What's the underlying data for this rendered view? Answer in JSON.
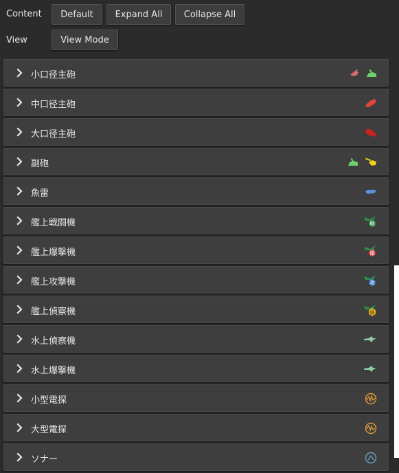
{
  "toolbar": {
    "content_label": "Content",
    "default_button": "Default",
    "expand_all_button": "Expand All",
    "collapse_all_button": "Collapse All",
    "view_label": "View",
    "view_mode_button": "View Mode"
  },
  "categories": [
    {
      "label": "小口径主砲",
      "icons": [
        "small-main-gun-red-icon",
        "small-main-gun-green-icon"
      ]
    },
    {
      "label": "中口径主砲",
      "icons": [
        "medium-main-gun-icon"
      ]
    },
    {
      "label": "大口径主砲",
      "icons": [
        "large-main-gun-icon"
      ]
    },
    {
      "label": "副砲",
      "icons": [
        "secondary-gun-green-icon",
        "secondary-gun-yellow-icon"
      ]
    },
    {
      "label": "魚雷",
      "icons": [
        "torpedo-icon"
      ]
    },
    {
      "label": "艦上戦闘機",
      "icons": [
        "carrier-fighter-icon"
      ]
    },
    {
      "label": "艦上爆撃機",
      "icons": [
        "carrier-dive-bomber-icon"
      ]
    },
    {
      "label": "艦上攻撃機",
      "icons": [
        "carrier-torpedo-bomber-icon"
      ]
    },
    {
      "label": "艦上偵察機",
      "icons": [
        "carrier-recon-icon"
      ]
    },
    {
      "label": "水上偵察機",
      "icons": [
        "seaplane-recon-icon"
      ]
    },
    {
      "label": "水上爆撃機",
      "icons": [
        "seaplane-bomber-icon"
      ]
    },
    {
      "label": "小型電探",
      "icons": [
        "small-radar-icon"
      ]
    },
    {
      "label": "大型電探",
      "icons": [
        "large-radar-icon"
      ]
    },
    {
      "label": "ソナー",
      "icons": [
        "sonar-icon"
      ]
    }
  ],
  "colors": {
    "background": "#2b2b2b",
    "row": "#3e3e3e",
    "button": "#3d3d3d",
    "text": "#e6e6e6",
    "gun_red_light": "#d86a6a",
    "gun_red": "#e0433e",
    "gun_red_dark": "#c8231f",
    "gun_green": "#6fcf6f",
    "gun_yellow": "#f2d21a",
    "torpedo_blue": "#5b8fd6",
    "aircraft_green": "#2f8f4a",
    "seaplane_green": "#8fc9a0",
    "radar_orange": "#e09a3a",
    "sonar_blue": "#6aa2c8"
  }
}
